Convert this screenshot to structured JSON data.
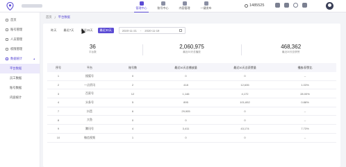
{
  "topnav": {
    "items": [
      {
        "label": "管理中心",
        "active": true
      },
      {
        "label": "账号中心",
        "active": false
      },
      {
        "label": "内容管理",
        "active": false
      },
      {
        "label": "一键发布",
        "active": false
      }
    ],
    "coins": "1485525",
    "accent": "#5b4bd4"
  },
  "sidebar": {
    "items": [
      {
        "label": "首页",
        "icon": "home-icon"
      },
      {
        "label": "账号管理",
        "icon": "account-icon"
      },
      {
        "label": "人员管理",
        "icon": "people-icon"
      },
      {
        "label": "权限管理",
        "icon": "permission-icon"
      }
    ],
    "group": {
      "label": "数据统计",
      "icon": "chart-icon"
    },
    "sub": [
      {
        "label": "平台数据",
        "active": true
      },
      {
        "label": "员工数据",
        "active": false
      },
      {
        "label": "账号数据",
        "active": false
      },
      {
        "label": "内容统计",
        "active": false
      }
    ]
  },
  "breadcrumb": {
    "home": "首页",
    "sep": "/",
    "current": "平台数据"
  },
  "filters": {
    "buttons": [
      "昨天",
      "最近7天",
      "最近15天",
      "最近30天"
    ],
    "active_index": 3,
    "date_start": "2020-11-21",
    "date_sep": "-",
    "date_end": "2020-11-19"
  },
  "stats": [
    {
      "value": "36",
      "label": "平台数"
    },
    {
      "value": "2,060,975",
      "label": "最近30天总播放"
    },
    {
      "value": "468,362",
      "label": "最近30天总获赞"
    }
  ],
  "table": {
    "headers": [
      "序号",
      "平台",
      "账号数",
      "最近30天总播放量",
      "最近30天总获赞量",
      "播放/获赞比"
    ],
    "rows": [
      [
        "1",
        "搜狐号",
        "0",
        "0",
        "0",
        "--"
      ],
      [
        "2",
        "一点资讯",
        "2",
        "418",
        "12,635",
        "1.03%"
      ],
      [
        "3",
        "百家号",
        "12",
        "1,146",
        "4,172",
        "28.00%"
      ],
      [
        "4",
        "头条号",
        "5",
        "895",
        "101,652",
        "0.88%"
      ],
      [
        "7",
        "抖音",
        "6",
        "29,905",
        "0",
        "--"
      ],
      [
        "8",
        "大鱼",
        "0",
        "0",
        "0",
        "--"
      ],
      [
        "9",
        "腾讯号",
        "4",
        "3,411",
        "43,174",
        "7.73%"
      ],
      [
        "10",
        "微信视频",
        "1",
        "0",
        "0",
        "--"
      ]
    ]
  }
}
